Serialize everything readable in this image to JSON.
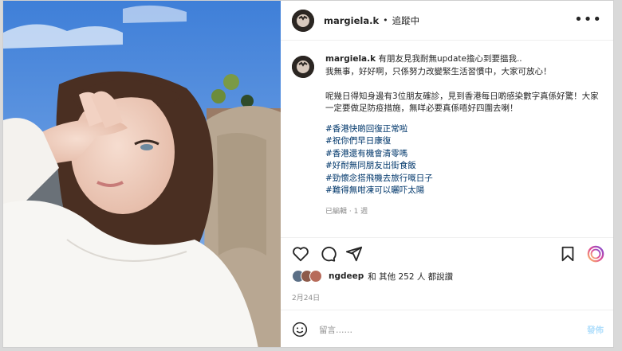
{
  "post": {
    "username": "margiela.k",
    "separator": "•",
    "follow_status": "追蹤中",
    "more_icon": "more-horizontal-icon",
    "caption": {
      "username": "margiela.k",
      "text": "有朋友見我耐無update擔心到要搵我..\n我無事，好好啊，只係努力改變緊生活習慣中，大家可放心！\n\n呢幾日得知身邊有3位朋友確診，見到香港每日啲感染數字真係好驚！大家一定要做足防疫措施，無咩必要真係唔好四圍去喇！",
      "hashtags": [
        "#香港快啲回復正常啦",
        "#祝你們早日康復",
        "#香港還有機會清零嗎",
        "#好耐無同朋友出街食飯",
        "#勁懷念搭飛機去旅行嘅日子",
        "#難得無咁凍可以曬吓太陽"
      ],
      "edited": "已編輯 · 1 週"
    },
    "likes": {
      "user": "ngdeep",
      "text": "和 其他 252 人 都說讚"
    },
    "date": "2月24日",
    "comment": {
      "placeholder": "留言……",
      "post_label": "發佈"
    },
    "colors": {
      "hashtag": "#00376b",
      "secondary": "#8e8e8e",
      "post_button": "#b2dffc"
    }
  }
}
